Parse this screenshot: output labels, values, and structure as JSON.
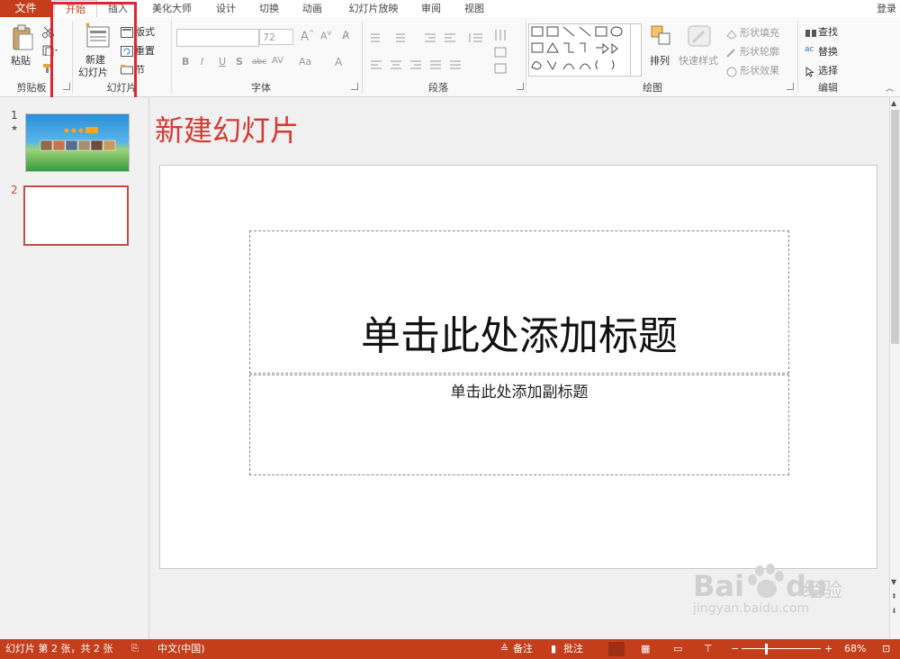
{
  "tabs": {
    "file": "文件",
    "home": "开始",
    "insert": "插入",
    "beautify": "美化大师",
    "design": "设计",
    "transitions": "切换",
    "animations": "动画",
    "slideshow": "幻灯片放映",
    "review": "审阅",
    "view": "视图",
    "login": "登录"
  },
  "ribbon": {
    "clipboard": {
      "paste": "粘贴",
      "label": "剪贴板"
    },
    "slides": {
      "new_slide_line1": "新建",
      "new_slide_line2": "幻灯片",
      "layout": "版式",
      "reset": "重置",
      "section": "节",
      "label": "幻灯片"
    },
    "font": {
      "size": "72",
      "label": "字体"
    },
    "paragraph": {
      "label": "段落"
    },
    "drawing": {
      "arrange": "排列",
      "quick_styles": "快速样式",
      "shape_fill": "形状填充",
      "shape_outline": "形状轮廓",
      "shape_effects": "形状效果",
      "label": "绘图"
    },
    "editing": {
      "find": "查找",
      "replace": "替换",
      "select": "选择",
      "label": "编辑"
    }
  },
  "thumbnails": [
    {
      "number": "1",
      "marker": "★"
    },
    {
      "number": "2"
    }
  ],
  "overlay_title": "新建幻灯片",
  "slide": {
    "title_placeholder": "单击此处添加标题",
    "subtitle_placeholder": "单击此处添加副标题"
  },
  "status": {
    "slide_info": "幻灯片 第 2 张，共 2 张",
    "language": "中文(中国)",
    "notes": "备注",
    "comments": "批注",
    "zoom": "68%"
  },
  "watermark": {
    "brand_top": "Bai",
    "brand_suffix": "经验",
    "url": "jingyan.baidu.com"
  },
  "colors": {
    "accent": "#c43e1c",
    "highlight": "#e02432",
    "overlay_title": "#d43a33"
  }
}
